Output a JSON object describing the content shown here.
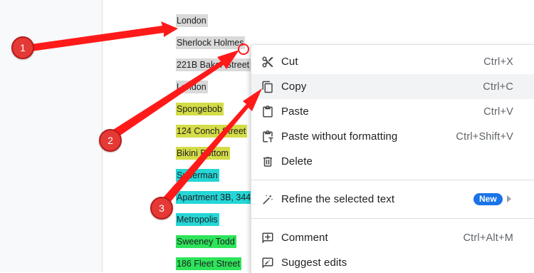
{
  "document": {
    "lines": [
      {
        "text": "London",
        "highlight": "#d9d9d9"
      },
      {
        "text": "Sherlock Holmes",
        "highlight": "#d9d9d9"
      },
      {
        "text": "221B Baker Street",
        "highlight": "#d9d9d9"
      },
      {
        "text": "London",
        "highlight": "#d9d9d9"
      },
      {
        "text": "Spongebob",
        "highlight": "#d4dc47"
      },
      {
        "text": "124 Conch Street",
        "highlight": "#d4dc47"
      },
      {
        "text": "Bikini Bottom",
        "highlight": "#d4dc47"
      },
      {
        "text": "Superman",
        "highlight": "#25d6d6"
      },
      {
        "text": "Apartment 3B, 344",
        "highlight": "#25d6d6"
      },
      {
        "text": "Metropolis",
        "highlight": "#25d6d6"
      },
      {
        "text": "Sweeney Todd",
        "highlight": "#2ee45a"
      },
      {
        "text": "186 Fleet Street",
        "highlight": "#2ee45a"
      }
    ]
  },
  "context_menu": {
    "items": [
      {
        "id": "cut",
        "label": "Cut",
        "shortcut": "Ctrl+X",
        "icon": "scissors-icon"
      },
      {
        "id": "copy",
        "label": "Copy",
        "shortcut": "Ctrl+C",
        "icon": "copy-icon",
        "hovered": true
      },
      {
        "id": "paste",
        "label": "Paste",
        "shortcut": "Ctrl+V",
        "icon": "clipboard-icon"
      },
      {
        "id": "paste-plain",
        "label": "Paste without formatting",
        "shortcut": "Ctrl+Shift+V",
        "icon": "clipboard-format-icon"
      },
      {
        "id": "delete",
        "label": "Delete",
        "shortcut": "",
        "icon": "trash-icon"
      },
      {
        "id": "refine",
        "label": "Refine the selected text",
        "badge": "New",
        "icon": "magic-pen-icon"
      },
      {
        "id": "comment",
        "label": "Comment",
        "shortcut": "Ctrl+Alt+M",
        "icon": "comment-add-icon"
      },
      {
        "id": "suggest",
        "label": "Suggest edits",
        "shortcut": "",
        "icon": "suggest-edit-icon"
      }
    ]
  },
  "annotations": {
    "callouts": [
      "1",
      "2",
      "3"
    ],
    "arrow_color": "#ff1a1a",
    "callout_color": "#e53935"
  }
}
